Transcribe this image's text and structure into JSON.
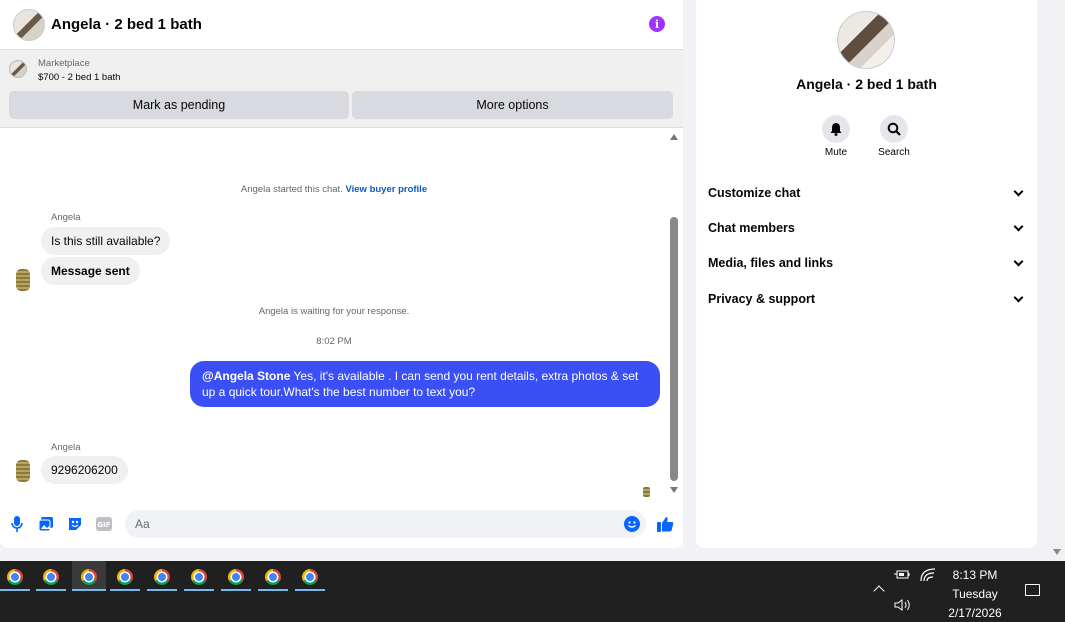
{
  "chat": {
    "title": "Angela · 2 bed 1 bath",
    "marketplace_label": "Marketplace",
    "listing": "$700 - 2 bed 1 bath",
    "mark_pending": "Mark as pending",
    "more_options": "More options",
    "started_text": "Angela started this chat.",
    "view_profile": "View buyer profile",
    "sender1": "Angela",
    "msg1": "Is this still available?",
    "msg2": "Message sent",
    "waiting": "Angela is waiting for your response.",
    "time": "8:02 PM",
    "reply_mention": "@Angela Stone",
    "reply_text": " Yes, it's available .  I can send you rent details, extra photos & set up a quick tour.What's the best number to text you?",
    "sender2": "Angela",
    "msg3": "9296206200",
    "input_placeholder": "Aa"
  },
  "info": {
    "name": "Angela · 2 bed 1 bath",
    "mute": "Mute",
    "search": "Search",
    "sections": [
      "Customize chat",
      "Chat members",
      "Media, files and links",
      "Privacy & support"
    ]
  },
  "taskbar": {
    "time": "8:13 PM",
    "day": "Tuesday",
    "date": "2/17/2026"
  },
  "colors": {
    "accent": "#0866ff",
    "bubble_out": "#3b4ff7",
    "info_icon": "#a033ff"
  }
}
